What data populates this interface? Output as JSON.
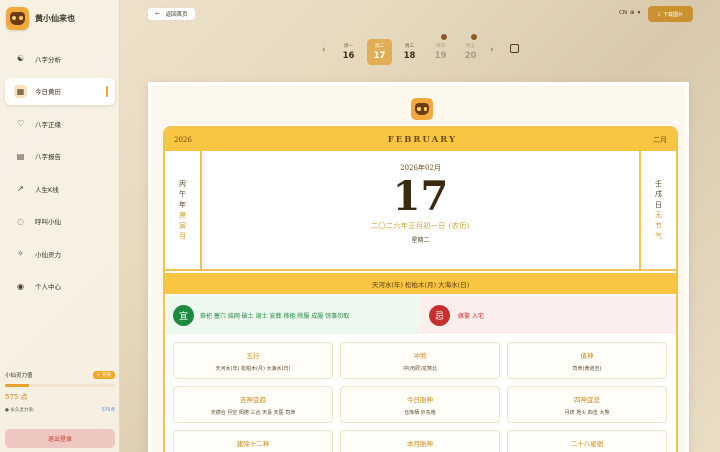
{
  "app": {
    "name": "黄小仙来也"
  },
  "sidebar": {
    "items": [
      {
        "label": "八字分析",
        "icon": "yin-yang-icon"
      },
      {
        "label": "今日黄历",
        "icon": "calendar-icon"
      },
      {
        "label": "八字正缘",
        "icon": "heart-icon"
      },
      {
        "label": "八字报告",
        "icon": "document-icon"
      },
      {
        "label": "人生K线",
        "icon": "trend-icon"
      },
      {
        "label": "呼叫小仙",
        "icon": "chat-icon"
      },
      {
        "label": "小仙灵力",
        "icon": "sparkle-icon"
      },
      {
        "label": "个人中心",
        "icon": "user-icon"
      }
    ],
    "energy": {
      "title": "小仙灵力值",
      "recharge": "+ 充值",
      "value": "575 点",
      "fill_fraction": 0.22,
      "perm_label": "● 永久灵力值:",
      "perm_value": "575点"
    },
    "logout": "退出登录"
  },
  "topbar": {
    "back": "返回首页",
    "lang": "CN",
    "download": "下载图片"
  },
  "week": [
    {
      "name": "周一",
      "date": "16",
      "state": "normal"
    },
    {
      "name": "周二",
      "date": "17",
      "state": "selected"
    },
    {
      "name": "周三",
      "date": "18",
      "state": "normal"
    },
    {
      "name": "周四",
      "date": "19",
      "state": "dim"
    },
    {
      "name": "周五",
      "date": "20",
      "state": "dim"
    }
  ],
  "calendar": {
    "year": "2026",
    "month_en": "FEBRUARY",
    "month_cn": "二月",
    "left": {
      "line1": [
        "丙",
        "午",
        "年"
      ],
      "line2": [
        "庚",
        "寅",
        "月"
      ]
    },
    "right": {
      "line1": [
        "壬",
        "戌",
        "日"
      ],
      "line2": [
        "无",
        "节",
        "气"
      ]
    },
    "ym": "2026年02月",
    "day": "17",
    "lunar": "二〇二六年正月初一日 (农历)",
    "weekday": "星期二",
    "nayin": "天河水(年) 松柏木(月) 大海水(日)",
    "yi_badge": "宜",
    "yi": "祭祀 塞穴 结网 破土 谢土 安葬 移柩 除服 成服 馀事勿取",
    "ji_badge": "忌",
    "ji": "嫁娶 入宅"
  },
  "boxes": [
    {
      "title": "五行",
      "value": "天河水(年) 松柏木(月) 大海水(日)"
    },
    {
      "title": "冲煞",
      "value": "冲(丙辰)龙煞北"
    },
    {
      "title": "值神",
      "value": "司命(黄道吉)"
    },
    {
      "title": "吉神宜趋",
      "value": "天德合 月空 阳德 三合 天喜 天医 司命"
    },
    {
      "title": "今日胎神",
      "value": "仓库栖 外东南"
    },
    {
      "title": "四神宜忌",
      "value": "月厌 地火 四击 大煞"
    },
    {
      "title": "建除十二神",
      "value": ""
    },
    {
      "title": "本月胎神",
      "value": ""
    },
    {
      "title": "二十八星宿",
      "value": ""
    }
  ]
}
